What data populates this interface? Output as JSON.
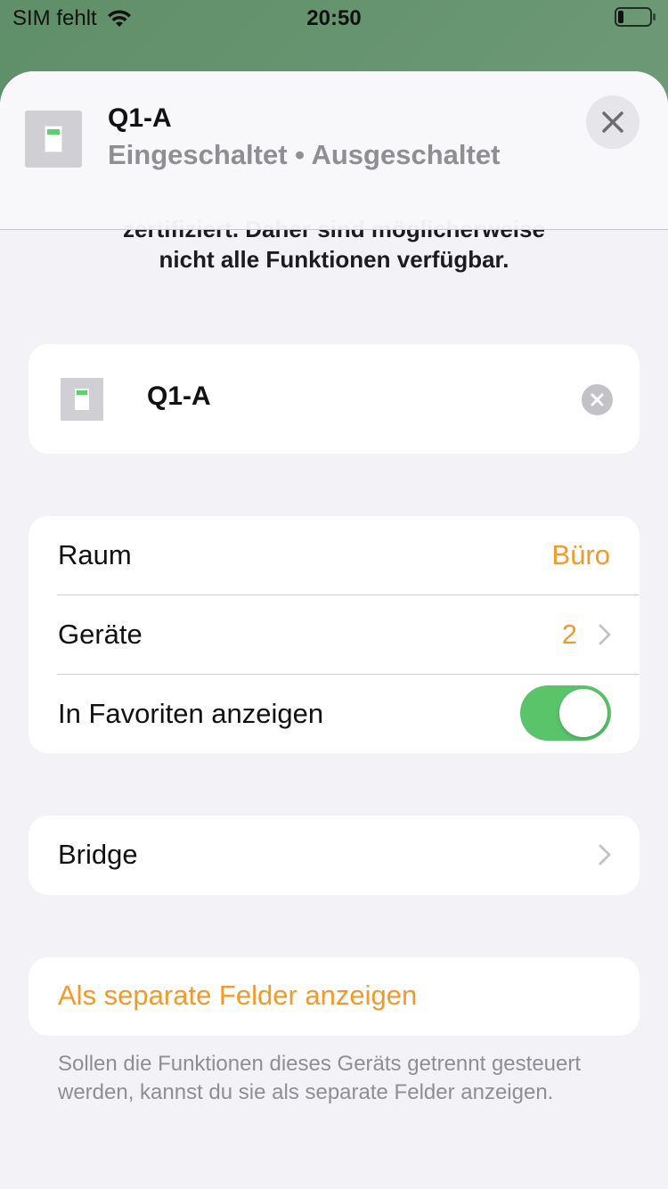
{
  "status_bar": {
    "carrier": "SIM fehlt",
    "time": "20:50"
  },
  "header": {
    "title": "Q1-A",
    "subtitle": "Eingeschaltet • Ausgeschaltet"
  },
  "notice": {
    "line1_partial": "zertifiziert. Daher sind möglicherweise",
    "line2": "nicht alle Funktionen verfügbar."
  },
  "name_field": {
    "value": "Q1-A"
  },
  "settings": {
    "room_label": "Raum",
    "room_value": "Büro",
    "devices_label": "Geräte",
    "devices_value": "2",
    "favorites_label": "In Favoriten anzeigen",
    "favorites_on": true
  },
  "bridge": {
    "label": "Bridge"
  },
  "separate": {
    "label": "Als separate Felder anzeigen",
    "footnote": "Sollen die Funktionen dieses Geräts getrennt gesteuert werden, kannst du sie als separate Felder anzeigen."
  },
  "colors": {
    "accent": "#f19a2b",
    "toggle_on": "#5ac46b"
  }
}
